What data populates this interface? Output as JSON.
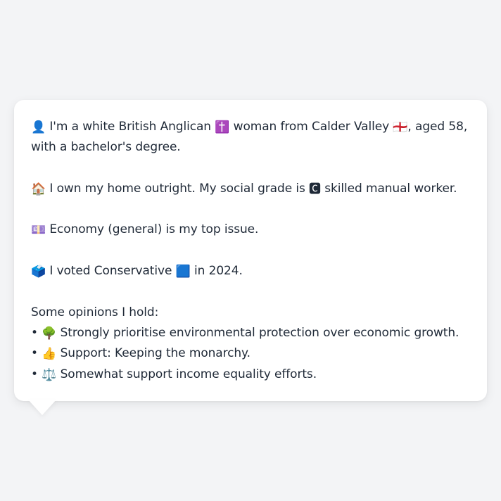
{
  "persona": {
    "intro": {
      "icon": "👤",
      "text_a": " I'm a white British Anglican ",
      "religion_icon": "✝️",
      "text_b": " woman from Calder Valley ",
      "flag_icon": "🏴󠁧󠁢󠁥󠁮󠁧󠁿",
      "text_c": ", aged 58,",
      "text_d": "with a bachelor's degree."
    },
    "home": {
      "icon": "🏠",
      "text_a": " I own my home outright. My social grade is ",
      "grade_icon": "🅲",
      "text_b": " skilled manual worker."
    },
    "issue": {
      "icon": "💷",
      "text": " Economy (general) is my top issue."
    },
    "vote": {
      "icon": "🗳️",
      "text_a": " I voted Conservative ",
      "party_icon": "🟦",
      "text_b": " in 2024."
    },
    "opinions": {
      "heading": "Some opinions I hold:",
      "items": [
        {
          "bullet": "• ",
          "icon": "🌳",
          "text": " Strongly prioritise environmental protection over economic growth."
        },
        {
          "bullet": "• ",
          "icon": "👍",
          "text": " Support: Keeping the monarchy."
        },
        {
          "bullet": "• ",
          "icon": "⚖️",
          "text": " Somewhat support income equality efforts."
        }
      ]
    }
  }
}
